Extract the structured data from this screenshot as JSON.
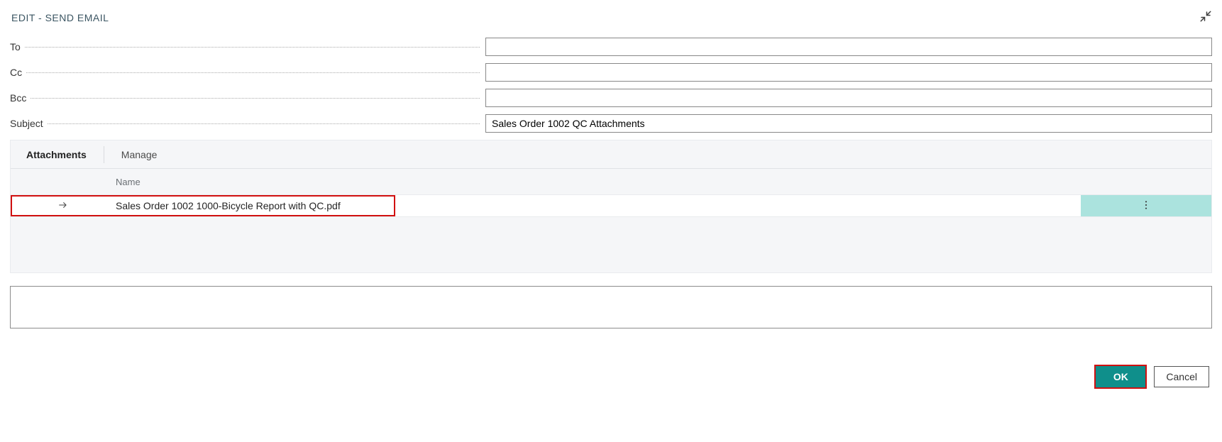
{
  "header": {
    "title": "EDIT - SEND EMAIL"
  },
  "form": {
    "to": {
      "label": "To",
      "value": ""
    },
    "cc": {
      "label": "Cc",
      "value": ""
    },
    "bcc": {
      "label": "Bcc",
      "value": ""
    },
    "subject": {
      "label": "Subject",
      "value": "Sales Order 1002 QC Attachments"
    }
  },
  "attachments": {
    "tabs": {
      "attachments": "Attachments",
      "manage": "Manage"
    },
    "columns": {
      "name": "Name"
    },
    "rows": [
      {
        "name": "Sales Order 1002 1000-Bicycle Report with QC.pdf"
      }
    ]
  },
  "body": {
    "value": ""
  },
  "footer": {
    "ok": "OK",
    "cancel": "Cancel"
  },
  "colors": {
    "accent": "#0f8f8b",
    "rowActionBg": "#abe3de",
    "highlight": "#d11010"
  }
}
